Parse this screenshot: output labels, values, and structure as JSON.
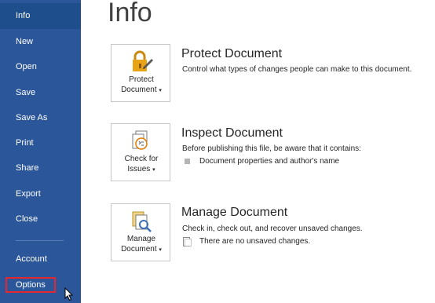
{
  "sidebar": {
    "items": [
      {
        "label": "Info"
      },
      {
        "label": "New"
      },
      {
        "label": "Open"
      },
      {
        "label": "Save"
      },
      {
        "label": "Save As"
      },
      {
        "label": "Print"
      },
      {
        "label": "Share"
      },
      {
        "label": "Export"
      },
      {
        "label": "Close"
      },
      {
        "label": "Account"
      },
      {
        "label": "Options"
      }
    ]
  },
  "page": {
    "title": "Info"
  },
  "sections": {
    "protect": {
      "tile_line1": "Protect",
      "tile_line2": "Document",
      "icon": "lock-icon",
      "title": "Protect Document",
      "desc": "Control what types of changes people can make to this document."
    },
    "inspect": {
      "tile_line1": "Check for",
      "tile_line2": "Issues",
      "icon": "inspect-document-icon",
      "title": "Inspect Document",
      "desc": "Before publishing this file, be aware that it contains:",
      "bullet": "Document properties and author's name"
    },
    "manage": {
      "tile_line1": "Manage",
      "tile_line2": "Document",
      "icon": "manage-document-icon",
      "title": "Manage Document",
      "desc": "Check in, check out, and recover unsaved changes.",
      "bullet": "There are no unsaved changes."
    }
  },
  "colors": {
    "sidebar": "#2b579a",
    "active": "#1e4e8c",
    "highlight": "#e3262f"
  }
}
